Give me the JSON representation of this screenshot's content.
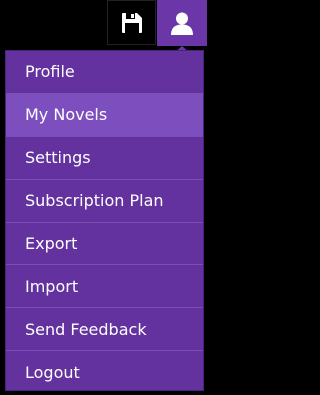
{
  "icons": {
    "save": "floppy-disk-icon",
    "user": "user-icon"
  },
  "colors": {
    "menu_bg": "#63329f",
    "menu_active_bg": "#7d4fbe",
    "user_button_bg": "#6a36a8",
    "text": "#ffffff"
  },
  "menu": {
    "items": [
      {
        "label": "Profile"
      },
      {
        "label": "My Novels",
        "active": true
      },
      {
        "label": "Settings"
      },
      {
        "label": "Subscription Plan"
      },
      {
        "label": "Export"
      },
      {
        "label": "Import"
      },
      {
        "label": "Send Feedback"
      },
      {
        "label": "Logout"
      }
    ]
  }
}
